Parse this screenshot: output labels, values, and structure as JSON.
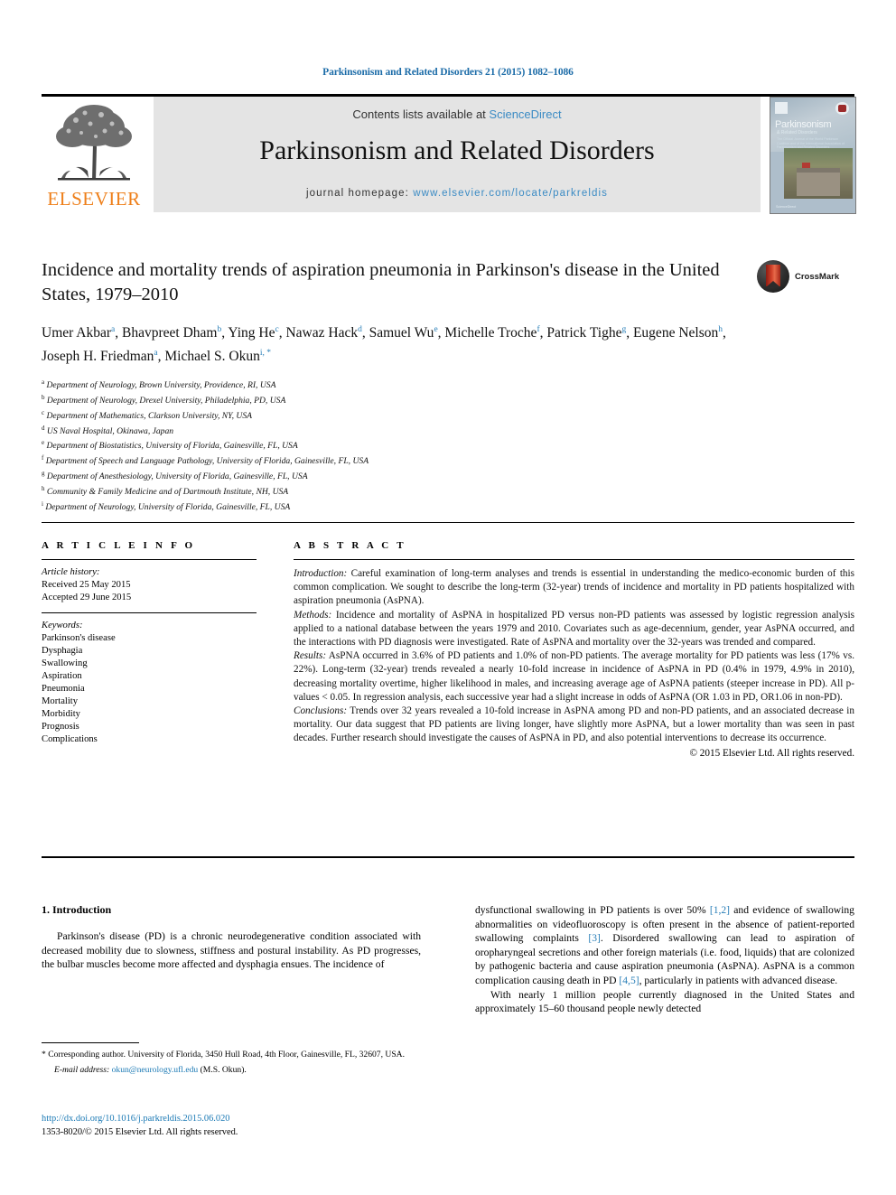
{
  "running_head": "Parkinsonism and Related Disorders 21 (2015) 1082–1086",
  "masthead": {
    "contents_prefix": "Contents lists available at ",
    "sciencedirect": "ScienceDirect",
    "journal_title": "Parkinsonism and Related Disorders",
    "homepage_label": "journal homepage: ",
    "homepage_url": "www.elsevier.com/locate/parkreldis",
    "publisher": "ELSEVIER",
    "cover": {
      "title": "Parkinsonism",
      "subtitle": "& Related Disorders",
      "blurb": "The Official Journal of the World Parkinson Coalition and of the International Association of Parkinsonism and Related Disorders",
      "footer": "ScienceDirect"
    },
    "crossmark_label": "CrossMark",
    "accent_link": "#3b8bc4",
    "accent_orange": "#ee7f1a",
    "band_bg": "#e4e4e4"
  },
  "article": {
    "title": "Incidence and mortality trends of aspiration pneumonia in Parkinson's disease in the United States, 1979–2010",
    "authors": [
      {
        "name": "Umer Akbar",
        "sup": "a"
      },
      {
        "name": "Bhavpreet Dham",
        "sup": "b"
      },
      {
        "name": "Ying He",
        "sup": "c"
      },
      {
        "name": "Nawaz Hack",
        "sup": "d"
      },
      {
        "name": "Samuel Wu",
        "sup": "e"
      },
      {
        "name": "Michelle Troche",
        "sup": "f"
      },
      {
        "name": "Patrick Tighe",
        "sup": "g"
      },
      {
        "name": "Eugene Nelson",
        "sup": "h"
      },
      {
        "name": "Joseph H. Friedman",
        "sup": "a"
      },
      {
        "name": "Michael S. Okun",
        "sup": "i, *"
      }
    ],
    "affiliations": [
      {
        "mark": "a",
        "text": "Department of Neurology, Brown University, Providence, RI, USA"
      },
      {
        "mark": "b",
        "text": "Department of Neurology, Drexel University, Philadelphia, PD, USA"
      },
      {
        "mark": "c",
        "text": "Department of Mathematics, Clarkson University, NY, USA"
      },
      {
        "mark": "d",
        "text": "US Naval Hospital, Okinawa, Japan"
      },
      {
        "mark": "e",
        "text": "Department of Biostatistics, University of Florida, Gainesville, FL, USA"
      },
      {
        "mark": "f",
        "text": "Department of Speech and Language Pathology, University of Florida, Gainesville, FL, USA"
      },
      {
        "mark": "g",
        "text": "Department of Anesthesiology, University of Florida, Gainesville, FL, USA"
      },
      {
        "mark": "h",
        "text": "Community & Family Medicine and of Dartmouth Institute, NH, USA"
      },
      {
        "mark": "i",
        "text": "Department of Neurology, University of Florida, Gainesville, FL, USA"
      }
    ]
  },
  "article_info": {
    "heading": "A R T I C L E   I N F O",
    "history_label": "Article history:",
    "history": [
      "Received 25 May 2015",
      "Accepted 29 June 2015"
    ],
    "keywords_label": "Keywords:",
    "keywords": [
      "Parkinson's disease",
      "Dysphagia",
      "Swallowing",
      "Aspiration",
      "Pneumonia",
      "Mortality",
      "Morbidity",
      "Prognosis",
      "Complications"
    ]
  },
  "abstract": {
    "heading": "A B S T R A C T",
    "sections": [
      {
        "label": "Introduction:",
        "text": " Careful examination of long-term analyses and trends is essential in understanding the medico-economic burden of this common complication. We sought to describe the long-term (32-year) trends of incidence and mortality in PD patients hospitalized with aspiration pneumonia (AsPNA)."
      },
      {
        "label": "Methods:",
        "text": " Incidence and mortality of AsPNA in hospitalized PD versus non-PD patients was assessed by logistic regression analysis applied to a national database between the years 1979 and 2010. Covariates such as age-decennium, gender, year AsPNA occurred, and the interactions with PD diagnosis were investigated. Rate of AsPNA and mortality over the 32-years was trended and compared."
      },
      {
        "label": "Results:",
        "text": " AsPNA occurred in 3.6% of PD patients and 1.0% of non-PD patients. The average mortality for PD patients was less (17% vs. 22%). Long-term (32-year) trends revealed a nearly 10-fold increase in incidence of AsPNA in PD (0.4% in 1979, 4.9% in 2010), decreasing mortality overtime, higher likelihood in males, and increasing average age of AsPNA patients (steeper increase in PD). All p-values < 0.05. In regression analysis, each successive year had a slight increase in odds of AsPNA (OR 1.03 in PD, OR1.06 in non-PD)."
      },
      {
        "label": "Conclusions:",
        "text": " Trends over 32 years revealed a 10-fold increase in AsPNA among PD and non-PD patients, and an associated decrease in mortality. Our data suggest that PD patients are living longer, have slightly more AsPNA, but a lower mortality than was seen in past decades. Further research should investigate the causes of AsPNA in PD, and also potential interventions to decrease its occurrence."
      }
    ],
    "copyright": "© 2015 Elsevier Ltd. All rights reserved."
  },
  "body": {
    "section_number_title": "1. Introduction",
    "left_paragraph": "Parkinson's disease (PD) is a chronic neurodegenerative condition associated with decreased mobility due to slowness, stiffness and postural instability. As PD progresses, the bulbar muscles become more affected and dysphagia ensues. The incidence of",
    "right_paragraph_1_a": "dysfunctional swallowing in PD patients is over 50% ",
    "right_cite_1": "[1,2]",
    "right_paragraph_1_b": " and evidence of swallowing abnormalities on videofluoroscopy is often present in the absence of patient-reported swallowing complaints ",
    "right_cite_2": "[3]",
    "right_paragraph_1_c": ". Disordered swallowing can lead to aspiration of oropharyngeal secretions and other foreign materials (i.e. food, liquids) that are colonized by pathogenic bacteria and cause aspiration pneumonia (AsPNA). AsPNA is a common complication causing death in PD ",
    "right_cite_3": "[4,5]",
    "right_paragraph_1_d": ", particularly in patients with advanced disease.",
    "right_paragraph_2": "With nearly 1 million people currently diagnosed in the United States and approximately 15–60 thousand people newly detected"
  },
  "footnote": {
    "marker": "*",
    "corresponding": " Corresponding author. University of Florida, 3450 Hull Road, 4th Floor, Gainesville, FL, 32607, USA.",
    "email_label": "E-mail address:",
    "email": "okun@neurology.ufl.edu",
    "email_owner": " (M.S. Okun)."
  },
  "footer": {
    "doi": "http://dx.doi.org/10.1016/j.parkreldis.2015.06.020",
    "issn_line": "1353-8020/© 2015 Elsevier Ltd. All rights reserved."
  }
}
